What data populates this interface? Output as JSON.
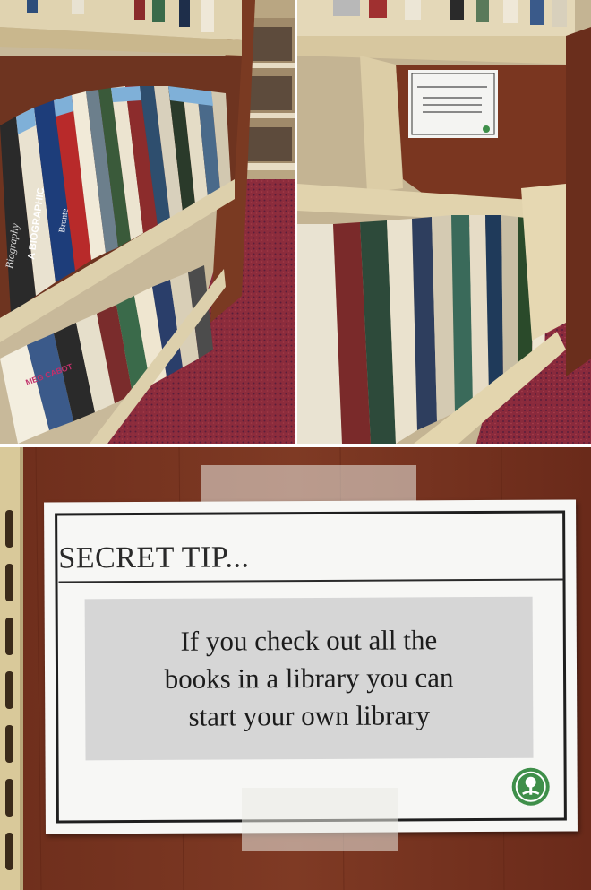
{
  "sign": {
    "title": "SECRET TIP...",
    "message": "If you check out all the\nbooks in a library you can\nstart your own library"
  },
  "spines": {
    "left_1": "A BIOGRAPHIC",
    "left_2": "Bronte",
    "left_3": "Biography",
    "left_4": "MEG CABOT"
  },
  "colors": {
    "shelf": "#d9c9a3",
    "wood": "#7a3a22",
    "carpet": "#8a2a3a",
    "logo": "#3f8f4a"
  },
  "icons": {
    "logo": "library-tree-icon"
  }
}
